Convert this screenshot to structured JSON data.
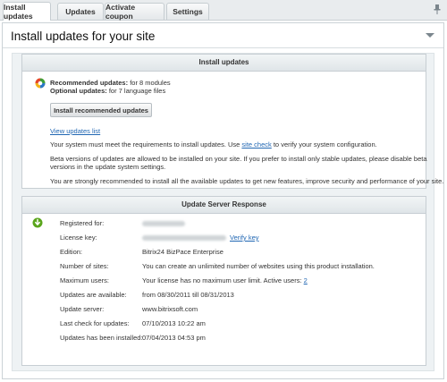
{
  "tabs": [
    {
      "label": "Install updates",
      "active": true
    },
    {
      "label": "Updates",
      "active": false
    },
    {
      "label": "Activate coupon",
      "active": false
    },
    {
      "label": "Settings",
      "active": false
    }
  ],
  "panel": {
    "title": "Install updates for your site"
  },
  "install_card": {
    "header": "Install updates",
    "recommended_label": "Recommended updates:",
    "recommended_value": "for 8 modules",
    "optional_label": "Optional updates:",
    "optional_value": "for 7 language files",
    "install_button": "Install recommended updates",
    "view_list_link": "View updates list",
    "req_prefix": "Your system must meet the requirements to install updates. Use ",
    "req_link": "site check",
    "req_suffix": " to verify your system configuration.",
    "beta_line1": "Beta versions of updates are allowed to be installed on your site. If you prefer to install only stable updates, please disable beta",
    "beta_line2": "versions in the update system settings.",
    "recommend_text": "You are strongly recommended to install all the available updates to get new features, improve security and performance of your site."
  },
  "server_card": {
    "header": "Update Server Response",
    "rows": [
      {
        "label": "Registered for:",
        "value": ""
      },
      {
        "label": "License key:",
        "value": "",
        "link": "Verify key"
      },
      {
        "label": "Edition:",
        "value": "Bitrix24 BizPace Enterprise"
      },
      {
        "label": "Number of sites:",
        "value": "You can create an unlimited number of websites using this product installation."
      },
      {
        "label": "Maximum users:",
        "value": "Your license has no maximum user limit. Active users: ",
        "link": "2"
      },
      {
        "label": "Updates are available:",
        "value": "from 08/30/2011 till 08/31/2013"
      },
      {
        "label": "Update server:",
        "value": "www.bitrixsoft.com"
      },
      {
        "label": "Last check for updates:",
        "value": "07/10/2013 10:22 am"
      },
      {
        "label": "Updates has been installed:",
        "value": "07/04/2013 04:53 pm"
      }
    ]
  },
  "colors": {
    "link": "#2167b3",
    "tab_bar": "#e9ecee",
    "inner_bg": "#eef2f4",
    "status_ok": "#5aa51c"
  }
}
